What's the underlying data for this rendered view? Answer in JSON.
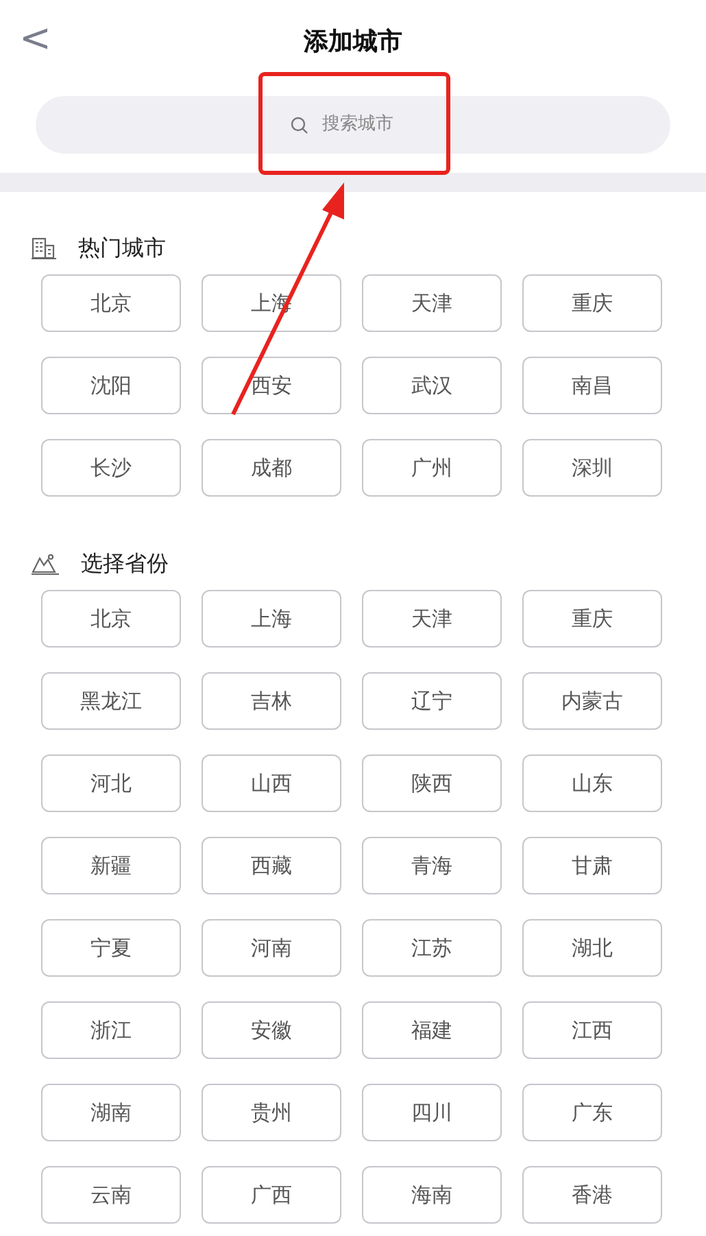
{
  "header": {
    "back": "<",
    "title": "添加城市"
  },
  "search": {
    "placeholder": "搜索城市"
  },
  "sections": [
    {
      "kind": "hot",
      "title": "热门城市",
      "items": [
        "北京",
        "上海",
        "天津",
        "重庆",
        "沈阳",
        "西安",
        "武汉",
        "南昌",
        "长沙",
        "成都",
        "广州",
        "深圳"
      ]
    },
    {
      "kind": "province",
      "title": "选择省份",
      "items": [
        "北京",
        "上海",
        "天津",
        "重庆",
        "黑龙江",
        "吉林",
        "辽宁",
        "内蒙古",
        "河北",
        "山西",
        "陕西",
        "山东",
        "新疆",
        "西藏",
        "青海",
        "甘肃",
        "宁夏",
        "河南",
        "江苏",
        "湖北",
        "浙江",
        "安徽",
        "福建",
        "江西",
        "湖南",
        "贵州",
        "四川",
        "广东",
        "云南",
        "广西",
        "海南",
        "香港"
      ]
    }
  ],
  "annotation": {
    "highlight_box": true,
    "arrow": true
  }
}
